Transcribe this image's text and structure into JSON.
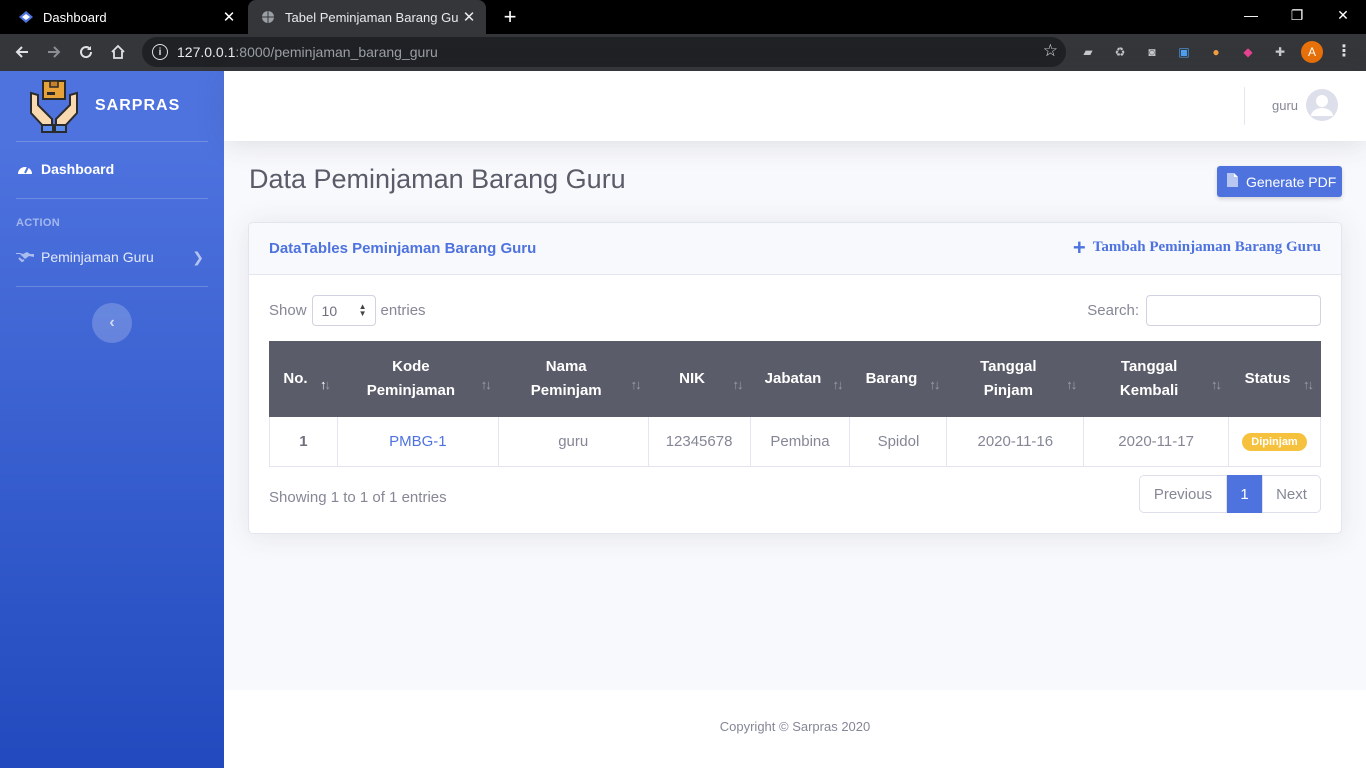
{
  "browser": {
    "tabs": [
      {
        "title": "Dashboard"
      },
      {
        "title": "Tabel Peminjaman Barang Guru"
      }
    ],
    "url_host": "127.0.0.1",
    "url_path": ":8000/peminjaman_barang_guru",
    "profile_initial": "A"
  },
  "sidebar": {
    "brand": "SARPRAS",
    "dashboard_label": "Dashboard",
    "heading": "ACTION",
    "pinjam_label": "Peminjaman Guru"
  },
  "topbar": {
    "username": "guru"
  },
  "page": {
    "title": "Data Peminjaman Barang Guru",
    "pdf_button": "Generate PDF"
  },
  "card": {
    "title": "DataTables Peminjaman Barang Guru",
    "add_link": "Tambah Peminjaman Barang Guru",
    "show_label": "Show",
    "entries_label": "entries",
    "length_value": "10",
    "search_label": "Search:",
    "search_value": "",
    "columns": [
      {
        "line1": "",
        "line2": "No."
      },
      {
        "line1": "Kode",
        "line2": "Peminjaman"
      },
      {
        "line1": "Nama",
        "line2": "Peminjam"
      },
      {
        "line1": "",
        "line2": "NIK"
      },
      {
        "line1": "",
        "line2": "Jabatan"
      },
      {
        "line1": "",
        "line2": "Barang"
      },
      {
        "line1": "Tanggal",
        "line2": "Pinjam"
      },
      {
        "line1": "Tanggal",
        "line2": "Kembali"
      },
      {
        "line1": "",
        "line2": "Status"
      }
    ],
    "rows": [
      {
        "no": "1",
        "kode": "PMBG-1",
        "nama": "guru",
        "nik": "12345678",
        "jabatan": "Pembina",
        "barang": "Spidol",
        "tgl_pinjam": "2020-11-16",
        "tgl_kembali": "2020-11-17",
        "status": "Dipinjam"
      }
    ],
    "info": "Showing 1 to 1 of 1 entries",
    "pager": {
      "prev": "Previous",
      "current": "1",
      "next": "Next"
    }
  },
  "footer": {
    "copyright": "Copyright © Sarpras 2020"
  },
  "colors": {
    "primary": "#4e73df",
    "warning": "#f6c23e",
    "table_header": "#5a5c69"
  }
}
